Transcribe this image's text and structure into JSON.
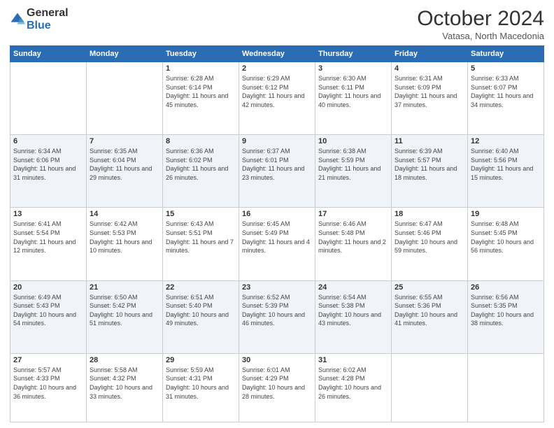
{
  "logo": {
    "text_general": "General",
    "text_blue": "Blue"
  },
  "header": {
    "month": "October 2024",
    "location": "Vatasa, North Macedonia"
  },
  "days_of_week": [
    "Sunday",
    "Monday",
    "Tuesday",
    "Wednesday",
    "Thursday",
    "Friday",
    "Saturday"
  ],
  "weeks": [
    [
      {
        "day": "",
        "sunrise": "",
        "sunset": "",
        "daylight": ""
      },
      {
        "day": "",
        "sunrise": "",
        "sunset": "",
        "daylight": ""
      },
      {
        "day": "1",
        "sunrise": "Sunrise: 6:28 AM",
        "sunset": "Sunset: 6:14 PM",
        "daylight": "Daylight: 11 hours and 45 minutes."
      },
      {
        "day": "2",
        "sunrise": "Sunrise: 6:29 AM",
        "sunset": "Sunset: 6:12 PM",
        "daylight": "Daylight: 11 hours and 42 minutes."
      },
      {
        "day": "3",
        "sunrise": "Sunrise: 6:30 AM",
        "sunset": "Sunset: 6:11 PM",
        "daylight": "Daylight: 11 hours and 40 minutes."
      },
      {
        "day": "4",
        "sunrise": "Sunrise: 6:31 AM",
        "sunset": "Sunset: 6:09 PM",
        "daylight": "Daylight: 11 hours and 37 minutes."
      },
      {
        "day": "5",
        "sunrise": "Sunrise: 6:33 AM",
        "sunset": "Sunset: 6:07 PM",
        "daylight": "Daylight: 11 hours and 34 minutes."
      }
    ],
    [
      {
        "day": "6",
        "sunrise": "Sunrise: 6:34 AM",
        "sunset": "Sunset: 6:06 PM",
        "daylight": "Daylight: 11 hours and 31 minutes."
      },
      {
        "day": "7",
        "sunrise": "Sunrise: 6:35 AM",
        "sunset": "Sunset: 6:04 PM",
        "daylight": "Daylight: 11 hours and 29 minutes."
      },
      {
        "day": "8",
        "sunrise": "Sunrise: 6:36 AM",
        "sunset": "Sunset: 6:02 PM",
        "daylight": "Daylight: 11 hours and 26 minutes."
      },
      {
        "day": "9",
        "sunrise": "Sunrise: 6:37 AM",
        "sunset": "Sunset: 6:01 PM",
        "daylight": "Daylight: 11 hours and 23 minutes."
      },
      {
        "day": "10",
        "sunrise": "Sunrise: 6:38 AM",
        "sunset": "Sunset: 5:59 PM",
        "daylight": "Daylight: 11 hours and 21 minutes."
      },
      {
        "day": "11",
        "sunrise": "Sunrise: 6:39 AM",
        "sunset": "Sunset: 5:57 PM",
        "daylight": "Daylight: 11 hours and 18 minutes."
      },
      {
        "day": "12",
        "sunrise": "Sunrise: 6:40 AM",
        "sunset": "Sunset: 5:56 PM",
        "daylight": "Daylight: 11 hours and 15 minutes."
      }
    ],
    [
      {
        "day": "13",
        "sunrise": "Sunrise: 6:41 AM",
        "sunset": "Sunset: 5:54 PM",
        "daylight": "Daylight: 11 hours and 12 minutes."
      },
      {
        "day": "14",
        "sunrise": "Sunrise: 6:42 AM",
        "sunset": "Sunset: 5:53 PM",
        "daylight": "Daylight: 11 hours and 10 minutes."
      },
      {
        "day": "15",
        "sunrise": "Sunrise: 6:43 AM",
        "sunset": "Sunset: 5:51 PM",
        "daylight": "Daylight: 11 hours and 7 minutes."
      },
      {
        "day": "16",
        "sunrise": "Sunrise: 6:45 AM",
        "sunset": "Sunset: 5:49 PM",
        "daylight": "Daylight: 11 hours and 4 minutes."
      },
      {
        "day": "17",
        "sunrise": "Sunrise: 6:46 AM",
        "sunset": "Sunset: 5:48 PM",
        "daylight": "Daylight: 11 hours and 2 minutes."
      },
      {
        "day": "18",
        "sunrise": "Sunrise: 6:47 AM",
        "sunset": "Sunset: 5:46 PM",
        "daylight": "Daylight: 10 hours and 59 minutes."
      },
      {
        "day": "19",
        "sunrise": "Sunrise: 6:48 AM",
        "sunset": "Sunset: 5:45 PM",
        "daylight": "Daylight: 10 hours and 56 minutes."
      }
    ],
    [
      {
        "day": "20",
        "sunrise": "Sunrise: 6:49 AM",
        "sunset": "Sunset: 5:43 PM",
        "daylight": "Daylight: 10 hours and 54 minutes."
      },
      {
        "day": "21",
        "sunrise": "Sunrise: 6:50 AM",
        "sunset": "Sunset: 5:42 PM",
        "daylight": "Daylight: 10 hours and 51 minutes."
      },
      {
        "day": "22",
        "sunrise": "Sunrise: 6:51 AM",
        "sunset": "Sunset: 5:40 PM",
        "daylight": "Daylight: 10 hours and 49 minutes."
      },
      {
        "day": "23",
        "sunrise": "Sunrise: 6:52 AM",
        "sunset": "Sunset: 5:39 PM",
        "daylight": "Daylight: 10 hours and 46 minutes."
      },
      {
        "day": "24",
        "sunrise": "Sunrise: 6:54 AM",
        "sunset": "Sunset: 5:38 PM",
        "daylight": "Daylight: 10 hours and 43 minutes."
      },
      {
        "day": "25",
        "sunrise": "Sunrise: 6:55 AM",
        "sunset": "Sunset: 5:36 PM",
        "daylight": "Daylight: 10 hours and 41 minutes."
      },
      {
        "day": "26",
        "sunrise": "Sunrise: 6:56 AM",
        "sunset": "Sunset: 5:35 PM",
        "daylight": "Daylight: 10 hours and 38 minutes."
      }
    ],
    [
      {
        "day": "27",
        "sunrise": "Sunrise: 5:57 AM",
        "sunset": "Sunset: 4:33 PM",
        "daylight": "Daylight: 10 hours and 36 minutes."
      },
      {
        "day": "28",
        "sunrise": "Sunrise: 5:58 AM",
        "sunset": "Sunset: 4:32 PM",
        "daylight": "Daylight: 10 hours and 33 minutes."
      },
      {
        "day": "29",
        "sunrise": "Sunrise: 5:59 AM",
        "sunset": "Sunset: 4:31 PM",
        "daylight": "Daylight: 10 hours and 31 minutes."
      },
      {
        "day": "30",
        "sunrise": "Sunrise: 6:01 AM",
        "sunset": "Sunset: 4:29 PM",
        "daylight": "Daylight: 10 hours and 28 minutes."
      },
      {
        "day": "31",
        "sunrise": "Sunrise: 6:02 AM",
        "sunset": "Sunset: 4:28 PM",
        "daylight": "Daylight: 10 hours and 26 minutes."
      },
      {
        "day": "",
        "sunrise": "",
        "sunset": "",
        "daylight": ""
      },
      {
        "day": "",
        "sunrise": "",
        "sunset": "",
        "daylight": ""
      }
    ]
  ]
}
